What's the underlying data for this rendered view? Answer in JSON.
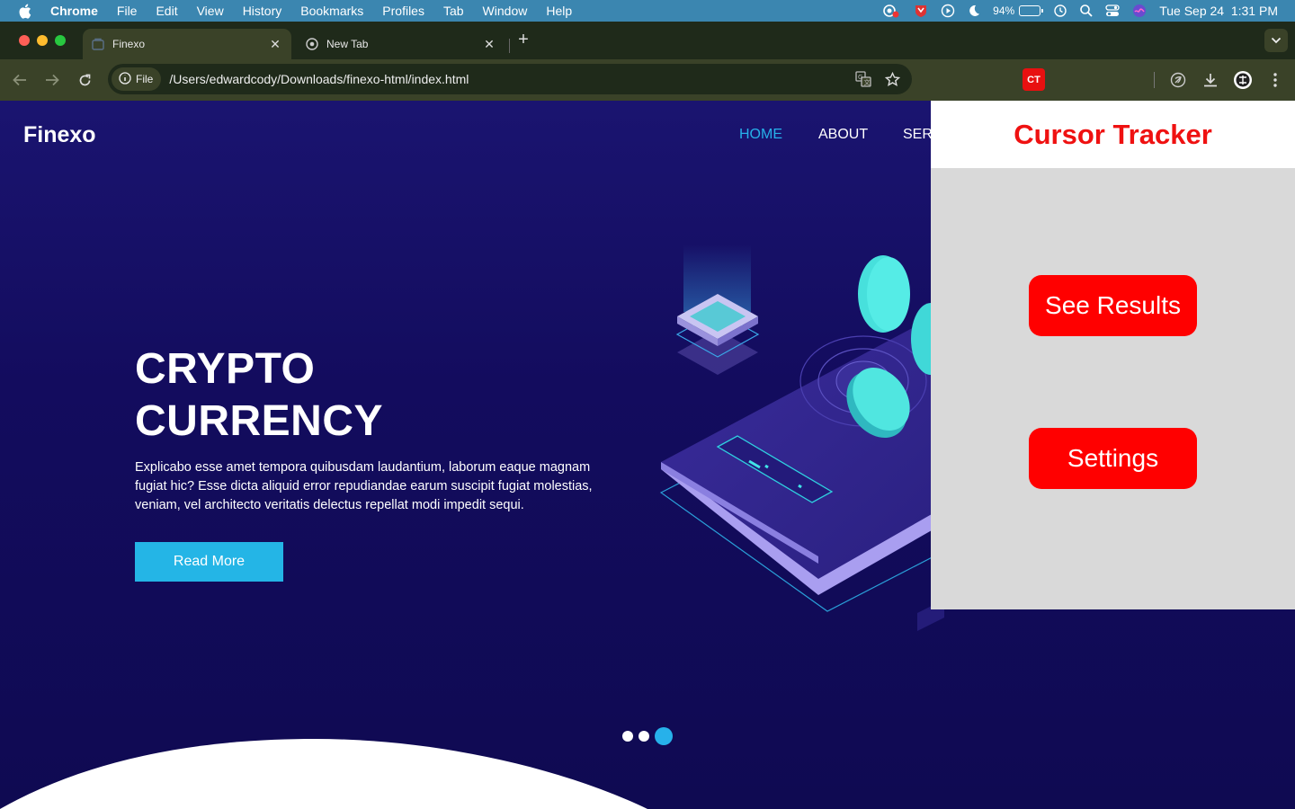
{
  "menubar": {
    "app_name": "Chrome",
    "items": [
      "File",
      "Edit",
      "View",
      "History",
      "Bookmarks",
      "Profiles",
      "Tab",
      "Window",
      "Help"
    ],
    "battery_percent": "94%",
    "datetime": "Tue Sep 24  1:31 PM"
  },
  "tabs": [
    {
      "title": "Finexo",
      "active": true
    },
    {
      "title": "New Tab",
      "active": false
    }
  ],
  "toolbar": {
    "site_chip": "File",
    "url": "/Users/edwardcody/Downloads/finexo-html/index.html",
    "extension_badge": "CT"
  },
  "page": {
    "logo": "Finexo",
    "nav": {
      "home": "HOME",
      "about": "ABOUT",
      "services_partial": "SERV"
    },
    "hero": {
      "title_line1": "CRYPTO",
      "title_line2": "CURRENCY",
      "text": "Explicabo esse amet tempora quibusdam laudantium, laborum eaque magnam fugiat hic? Esse dicta aliquid error repudiandae earum suscipit fugiat molestias, veniam, vel architecto veritatis delectus repellat modi impedit sequi.",
      "button": "Read More"
    },
    "carousel": {
      "slides": 3,
      "active_index": 2
    }
  },
  "extension_panel": {
    "title": "Cursor Tracker",
    "buttons": {
      "results": "See Results",
      "settings": "Settings"
    }
  },
  "colors": {
    "menubar": "#3b86b0",
    "tabstrip": "#1f2a1a",
    "toolbar": "#3a4228",
    "page_bg": "#130c5e",
    "accent": "#27b1ea",
    "ct_red": "#ff0000"
  }
}
